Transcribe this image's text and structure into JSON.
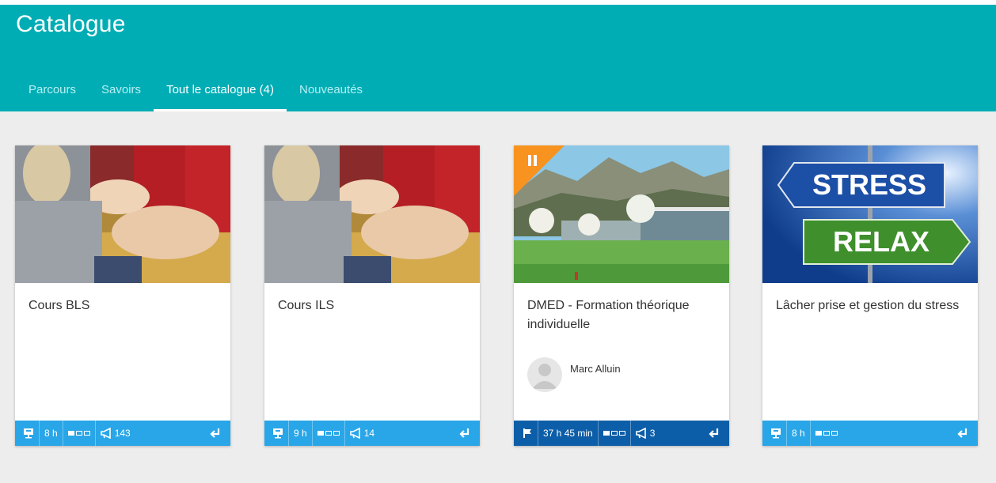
{
  "header": {
    "title": "Catalogue",
    "tabs": [
      {
        "label": "Parcours",
        "active": false
      },
      {
        "label": "Savoirs",
        "active": false
      },
      {
        "label": "Tout le catalogue (4)",
        "active": true
      },
      {
        "label": "Nouveautés",
        "active": false
      }
    ]
  },
  "colors": {
    "header": "#00adb5",
    "footer": "#29a6e8",
    "footer_dark": "#0d5ea8",
    "badge": "#f7931e"
  },
  "cards": [
    {
      "title": "Cours BLS",
      "type_icon": "presentation-icon",
      "duration": "8 h",
      "level_icon": "level-1-of-3-icon",
      "count": "143"
    },
    {
      "title": "Cours ILS",
      "type_icon": "presentation-icon",
      "duration": "9 h",
      "level_icon": "level-1-of-3-icon",
      "count": "14"
    },
    {
      "title": "DMED - Formation théorique individuelle",
      "type_icon": "flag-icon",
      "duration": "37 h 45 min",
      "level_icon": "level-1-of-3-icon",
      "count": "3",
      "author": "Marc Alluin",
      "badge_icon": "pause-icon"
    },
    {
      "title": "Lâcher prise et gestion du stress",
      "type_icon": "presentation-icon",
      "duration": "8 h",
      "level_icon": "level-1-of-3-icon",
      "image_text": [
        "STRESS",
        "RELAX"
      ]
    }
  ]
}
